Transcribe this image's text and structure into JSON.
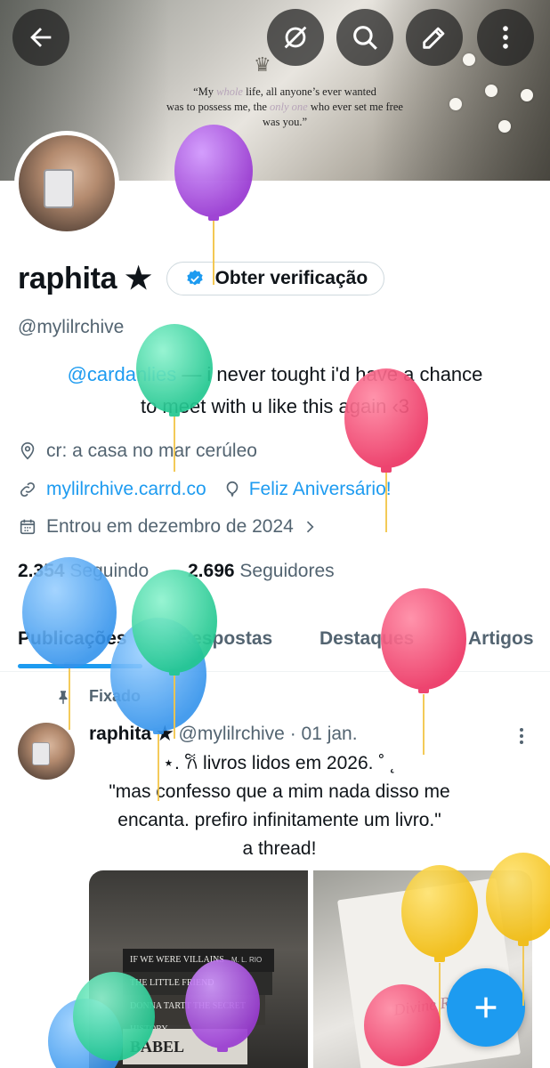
{
  "header": {
    "quote_lines": [
      "“My ",
      "whole",
      " life, all anyone’s ever wanted",
      "was to possess me, the ",
      "only one",
      " who ever set me free",
      "was you.”"
    ],
    "buttons": {
      "back_icon": "arrow-left-icon",
      "grok_icon": "grok-icon",
      "search_icon": "search-icon",
      "edit_icon": "edit-icon",
      "more_icon": "more-vertical-icon"
    }
  },
  "profile": {
    "name": "raphita ★",
    "verify_label": "Obter verificação",
    "handle": "@mylilrchive",
    "bio_mention": "@cardanlies",
    "bio_line1_rest": " — i never tought i'd have a chance",
    "bio_line2": "to meet with u like this again ‹3",
    "location": "cr: a casa no mar cerúleo",
    "website": "mylilrchive.carrd.co",
    "birthday": "Feliz Aniversário!",
    "joined": "Entrou em dezembro de 2024",
    "following_count": "2.354",
    "following_label": "Seguindo",
    "followers_count": "2.696",
    "followers_label": "Seguidores"
  },
  "tabs": [
    "Publicações",
    "Respostas",
    "Destaques",
    "Artigos"
  ],
  "post": {
    "pinned_label": "Fixado",
    "author_name": "raphita ★",
    "author_meta": "@mylilrchive · 01 jan.",
    "lines": [
      "⋆. 𐙚 livros lidos em 2026. ˚ ˛",
      "\"mas confesso que a mim nada disso me",
      "encanta. prefiro infinitamente um livro.\"",
      "a thread!"
    ],
    "book_titles": [
      "IF WE WERE VILLAINS",
      "THE LITTLE FRIEND",
      "DONNA TARTT THE SECRET HISTORY",
      "BABEL"
    ],
    "book_author": "M. L. RIO",
    "book2_title": "Divine Rivals"
  },
  "colors": {
    "accent": "#1d9bf0",
    "text": "#0f1419",
    "muted": "#536471",
    "balloon_purple": "#a040d8",
    "balloon_green": "#2fd6a0",
    "balloon_pink": "#f0406a",
    "balloon_blue": "#3d9ff0",
    "balloon_yellow": "#f6c20f"
  }
}
